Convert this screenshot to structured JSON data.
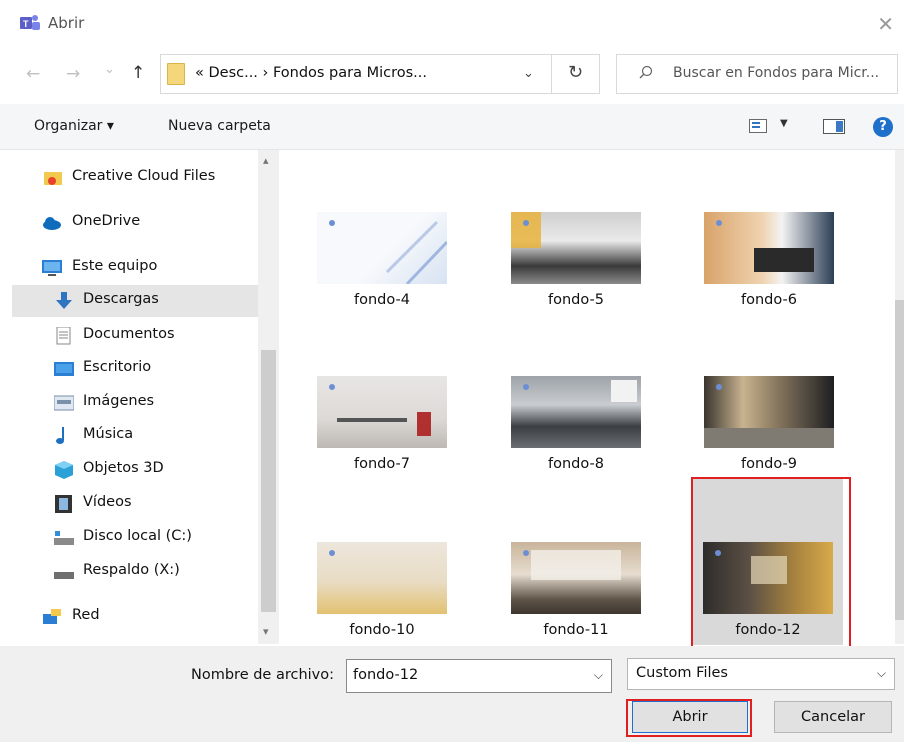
{
  "window": {
    "title": "Abrir",
    "close_glyph": "✕"
  },
  "nav": {
    "back_glyph": "←",
    "forward_glyph": "→",
    "recent_glyph": "⌄",
    "up_glyph": "↑",
    "address": "« Desc...  ›  Fondos para Micros...",
    "address_dropdown": "⌄",
    "refresh_glyph": "↻",
    "search_placeholder": "Buscar en Fondos para Micr..."
  },
  "toolbar": {
    "organize": "Organizar ▾",
    "new_folder": "Nueva carpeta",
    "view_dropdown": "▼",
    "help": "?"
  },
  "sidebar": {
    "scroll_up": "▴",
    "scroll_down": "▾",
    "items": [
      {
        "label": "Creative Cloud Files",
        "icon": "creative-cloud-folder"
      },
      {
        "label": "OneDrive",
        "icon": "cloud"
      },
      {
        "label": "Este equipo",
        "icon": "computer"
      },
      {
        "label": "Descargas",
        "icon": "download-arrow",
        "selected": true
      },
      {
        "label": "Documentos",
        "icon": "document"
      },
      {
        "label": "Escritorio",
        "icon": "desktop"
      },
      {
        "label": "Imágenes",
        "icon": "pictures"
      },
      {
        "label": "Música",
        "icon": "music-note"
      },
      {
        "label": "Objetos 3D",
        "icon": "cube"
      },
      {
        "label": "Vídeos",
        "icon": "film"
      },
      {
        "label": "Disco local (C:)",
        "icon": "drive"
      },
      {
        "label": "Respaldo (X:)",
        "icon": "drive"
      },
      {
        "label": "Red",
        "icon": "network"
      }
    ]
  },
  "files": [
    {
      "name": "fondo-4"
    },
    {
      "name": "fondo-5"
    },
    {
      "name": "fondo-6"
    },
    {
      "name": "fondo-7"
    },
    {
      "name": "fondo-8"
    },
    {
      "name": "fondo-9"
    },
    {
      "name": "fondo-10"
    },
    {
      "name": "fondo-11"
    },
    {
      "name": "fondo-12",
      "selected": true
    }
  ],
  "bottom": {
    "filename_label": "Nombre de archivo:",
    "filename_value": "fondo-12",
    "filetype": "Custom Files",
    "dropdown_glyph": "⌵",
    "open_label": "Abrir",
    "cancel_label": "Cancelar"
  },
  "colors": {
    "highlight": "#e02020",
    "accent": "#1e6fd0"
  }
}
